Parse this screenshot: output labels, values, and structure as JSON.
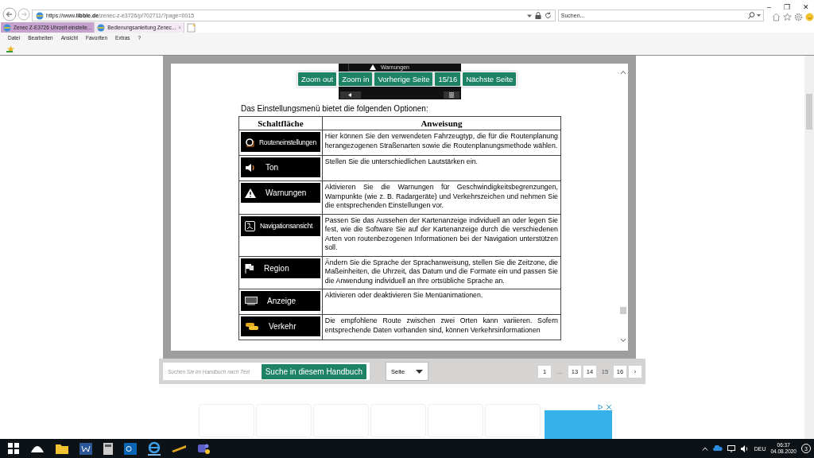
{
  "window": {
    "controls": [
      "–",
      "❐",
      "✕"
    ]
  },
  "address_bar": {
    "url_host_prefix": "https://www.",
    "url_host": "libble.de",
    "url_path": "/zenec-z-e3726/p/702711/?page=0015"
  },
  "search": {
    "placeholder": "Suchen..."
  },
  "tabs": [
    {
      "label": "Zenec Z-E3726 Uhrzeit einstelle...",
      "selected": false
    },
    {
      "label": "Bedienungsanleitung Zenec...",
      "selected": true,
      "close": "×"
    }
  ],
  "menu": [
    "Datei",
    "Bearbeiten",
    "Ansicht",
    "Favoriten",
    "Extras",
    "?"
  ],
  "viewer": {
    "image_text": "Warnungen",
    "buttons": [
      {
        "label": "Zoom out"
      },
      {
        "label": "Zoom in"
      },
      {
        "label": "Vorherige Seite"
      },
      {
        "label": "15/16"
      },
      {
        "label": "Nächste Seite"
      }
    ],
    "intro": "Das Einstellungsmenü bietet die folgenden Optionen:",
    "table": {
      "columns": [
        "Schaltfläche",
        "Anweisung"
      ],
      "rows": [
        {
          "kind": "gear",
          "button": "Routeneinstellungen",
          "text": "Hier können Sie den verwendeten Fahrzeugtyp, die für die Routenplanung herangezogenen Straßenarten sowie die Routenplanungsmethode wählen."
        },
        {
          "kind": "speaker",
          "button": "Ton",
          "text": "Stellen Sie die unterschiedlichen Lautstärken ein."
        },
        {
          "kind": "warning",
          "button": "Warnungen",
          "text": "Aktivieren Sie die Warnungen für Geschwindigkeitsbegrenzungen, Warnpunkte (wie z. B. Radargeräte) und Verkehrszeichen und nehmen Sie die entsprechenden Einstellungen vor."
        },
        {
          "kind": "map",
          "button": "Navigationsansicht",
          "text": "Passen Sie das Aussehen der Kartenanzeige individuell an oder legen Sie fest, wie die Software Sie auf der Kartenanzeige durch die verschiedenen Arten von routenbezogenen Informationen bei der Navigation unterstützen soll."
        },
        {
          "kind": "flag",
          "button": "Region",
          "text": "Ändern Sie die Sprache der Sprachanweisung, stellen Sie die Zeitzone, die Maßeinheiten, die Uhrzeit, das Datum und die Formate ein und passen Sie die Anwendung individuell an Ihre ortsübliche Sprache an."
        },
        {
          "kind": "display",
          "button": "Anzeige",
          "text": "Aktivieren oder deaktivieren Sie Menüanimationen."
        },
        {
          "kind": "cars",
          "button": "Verkehr",
          "text": "Die empfohlene Route zwischen zwei Orten kann variieren. Sofern entsprechende Daten vorhanden sind, können Verkehrsinformationen"
        }
      ]
    }
  },
  "toolbar": {
    "search_placeholder": "Suchen Sie im Handbuch nach Text",
    "search_button": "Suche in diesem Handbuch",
    "page_select": "Seite",
    "pages": [
      {
        "label": "1",
        "selected": false
      },
      {
        "label": "...",
        "kind": "gap"
      },
      {
        "label": "13",
        "selected": false
      },
      {
        "label": "14",
        "selected": false
      },
      {
        "label": "15",
        "selected": true
      },
      {
        "label": "16",
        "selected": false
      },
      {
        "label": "›",
        "selected": false
      }
    ]
  },
  "taskbar": {
    "language": "DEU",
    "time": "06:37",
    "date": "04.08.2020",
    "notifications": "3"
  }
}
